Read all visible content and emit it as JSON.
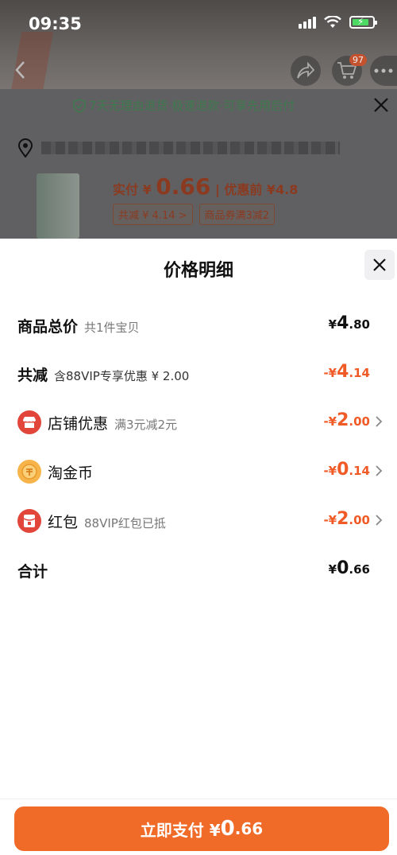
{
  "status_bar": {
    "time": "09:35"
  },
  "header": {
    "cart_badge": "97"
  },
  "background_order": {
    "guarantee": "7天无理由退货·极速退款·可享先用后付",
    "pay_label": "实付 ¥ ",
    "pay_value": "0.66",
    "pre_discount": " | 优惠前 ¥4.8",
    "tags": [
      "共减 ¥ 4.14 >",
      "商品券满3减2"
    ]
  },
  "modal": {
    "title": "价格明细",
    "rows": [
      {
        "label": "商品总价",
        "sub": "共1件宝贝",
        "currency": "¥",
        "int": "4",
        "dec": ".80",
        "negative": false
      },
      {
        "label": "共减",
        "sub": "含88VIP专享优惠 ¥ 2.00",
        "currency": "-¥",
        "int": "4",
        "dec": ".14",
        "negative": true
      },
      {
        "label": "店铺优惠",
        "sub": "满3元减2元",
        "currency": "-¥",
        "int": "2",
        "dec": ".00",
        "negative": true,
        "icon": "store-icon"
      },
      {
        "label": "淘金币",
        "sub": "",
        "currency": "-¥",
        "int": "0",
        "dec": ".14",
        "negative": true,
        "icon": "coin-icon"
      },
      {
        "label": "红包",
        "sub": "88VIP红包已抵",
        "currency": "-¥",
        "int": "2",
        "dec": ".00",
        "negative": true,
        "icon": "red-packet-icon"
      },
      {
        "label": "合计",
        "sub": "",
        "currency": "¥",
        "int": "0",
        "dec": ".66",
        "negative": false
      }
    ]
  },
  "pay_button": {
    "label": "立即支付 ¥",
    "int": "0",
    "dec": ".66"
  },
  "colors": {
    "accent": "#f06a28",
    "discount": "#f05a26",
    "icon_red": "#e2453a",
    "coin": "#f6b44a"
  }
}
